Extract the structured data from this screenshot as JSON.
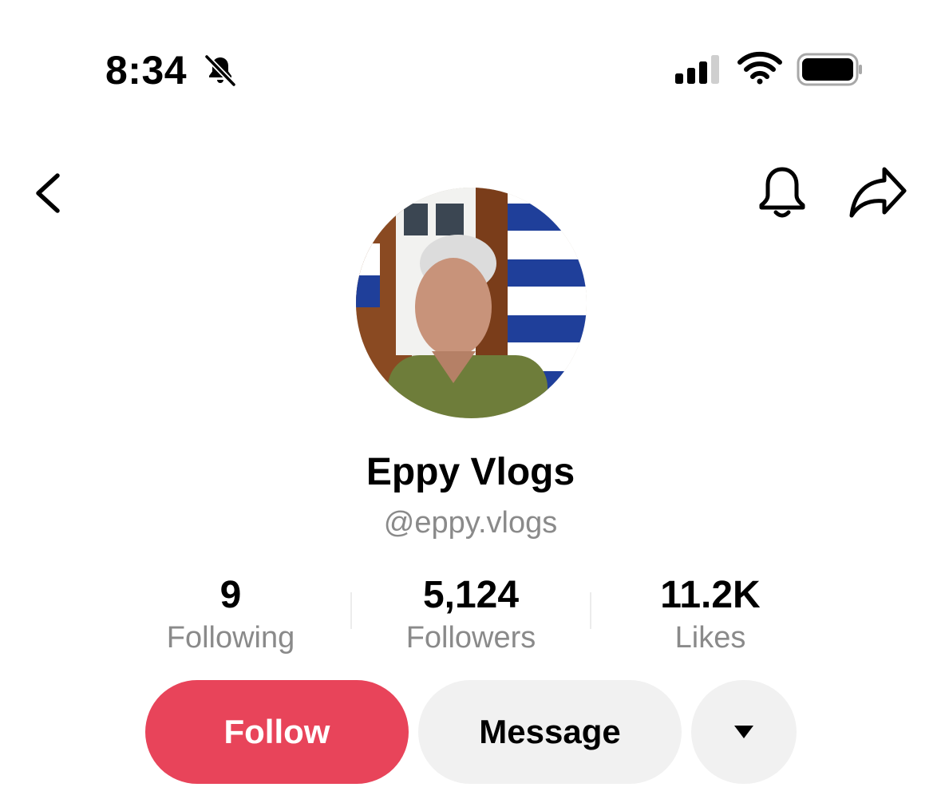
{
  "status_bar": {
    "time": "8:34",
    "mute_icon": "bell-slash-icon",
    "signal_icon": "cellular-signal-icon",
    "wifi_icon": "wifi-icon",
    "battery_icon": "battery-icon"
  },
  "nav": {
    "back_icon": "chevron-left-icon",
    "notifications_icon": "bell-icon",
    "share_icon": "share-arrow-icon"
  },
  "profile": {
    "display_name": "Eppy Vlogs",
    "handle": "@eppy.vlogs"
  },
  "stats": [
    {
      "value": "9",
      "label": "Following"
    },
    {
      "value": "5,124",
      "label": "Followers"
    },
    {
      "value": "11.2K",
      "label": "Likes"
    }
  ],
  "actions": {
    "follow_label": "Follow",
    "message_label": "Message",
    "more_icon": "caret-down-icon"
  },
  "colors": {
    "follow_button": "#e8445a",
    "secondary_button": "#f1f1f1",
    "muted_text": "#8a8a8a"
  }
}
